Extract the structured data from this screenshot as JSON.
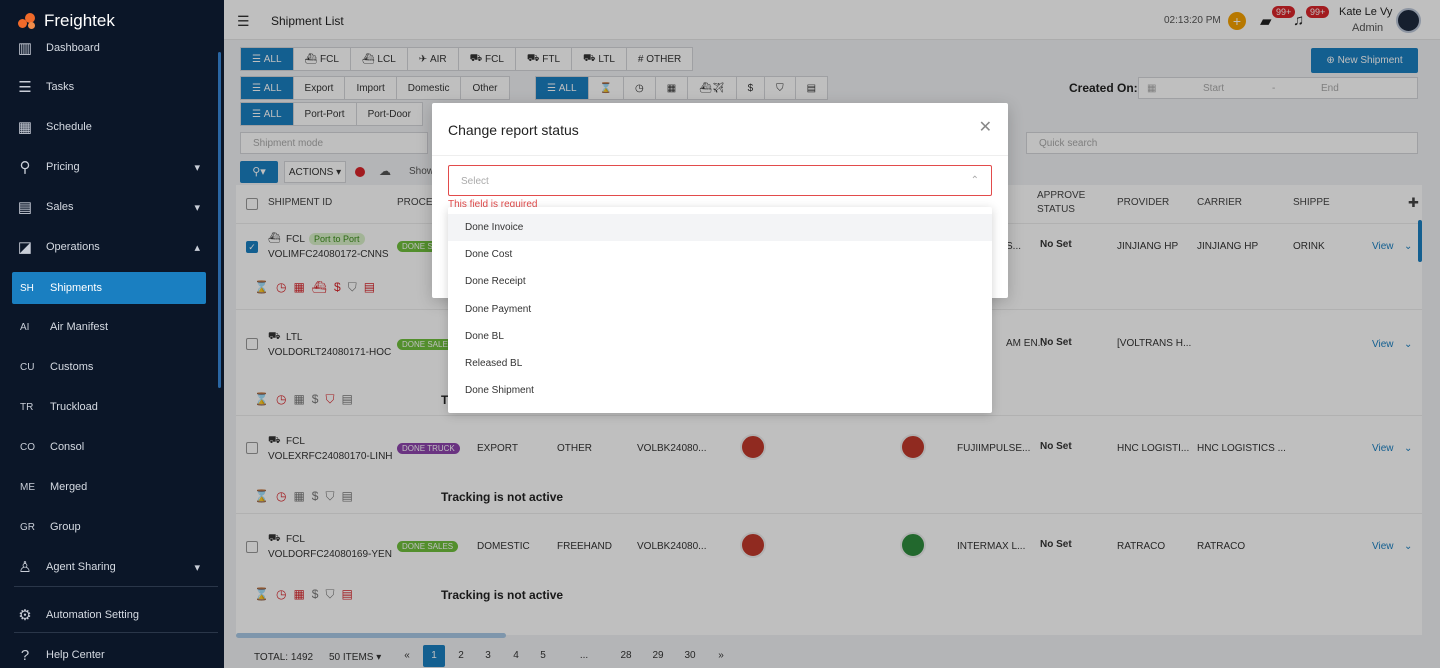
{
  "app": {
    "brand": "Freightek"
  },
  "header": {
    "title": "Shipment List",
    "time": "02:13:20 PM",
    "msg_badge": "99+",
    "notif_badge": "99+",
    "user_name": "Kate Le Vy",
    "user_role": "Admin"
  },
  "sidebar": {
    "items": [
      {
        "label": "Dashboard"
      },
      {
        "label": "Tasks"
      },
      {
        "label": "Schedule"
      },
      {
        "label": "Pricing"
      },
      {
        "label": "Sales"
      },
      {
        "label": "Operations"
      }
    ],
    "sub": [
      {
        "abbr": "SH",
        "label": "Shipments"
      },
      {
        "abbr": "AI",
        "label": "Air Manifest"
      },
      {
        "abbr": "CU",
        "label": "Customs"
      },
      {
        "abbr": "TR",
        "label": "Truckload"
      },
      {
        "abbr": "CO",
        "label": "Consol"
      },
      {
        "abbr": "ME",
        "label": "Merged"
      },
      {
        "abbr": "GR",
        "label": "Group"
      }
    ],
    "agent_sharing": "Agent Sharing",
    "automation": "Automation Setting",
    "help": "Help Center"
  },
  "filters": {
    "mode_tabs": [
      "ALL",
      "FCL",
      "LCL",
      "AIR",
      "FCL",
      "FTL",
      "LTL",
      "OTHER"
    ],
    "type_tabs": [
      "ALL",
      "Export",
      "Import",
      "Domestic",
      "Other"
    ],
    "status_tabs": [
      "ALL"
    ],
    "route_tabs": [
      "ALL",
      "Port-Port",
      "Port-Door"
    ],
    "new_shipment": "New Shipment",
    "created_on": "Created On:",
    "date_start": "Start",
    "date_sep": "-",
    "date_end": "End",
    "shipment_mode_placeholder": "Shipment mode",
    "quick_search_placeholder": "Quick search",
    "actions": "ACTIONS",
    "show": "Show"
  },
  "table": {
    "headers": {
      "shipment_id": "SHIPMENT ID",
      "process": "PROCES",
      "approve": "APPROVE",
      "status": "STATUS",
      "provider": "PROVIDER",
      "carrier": "CARRIER",
      "shipper": "SHIPPE"
    },
    "rows": [
      {
        "mode": "FCL",
        "route_tag": "Port to Port",
        "id": "VOLIMFC24080172-CNNS",
        "tag": "DONE S",
        "approve": "No Set",
        "shipper_col": "S...",
        "provider": "JINJIANG HP",
        "carrier": "JINJIANG HP",
        "shipper": "ORINK",
        "view": "View"
      },
      {
        "mode": "LTL",
        "id": "VOLDORLT24080171-HOC",
        "tag": "DONE SALES",
        "approve": "No Set",
        "shipper_col": "AM EN...",
        "provider": "[VOLTRANS H...",
        "carrier": "",
        "view": "View",
        "tracking": "T"
      },
      {
        "mode": "FCL",
        "id": "VOLEXRFC24080170-LINH",
        "tag": "DONE TRUCK",
        "type": "EXPORT",
        "sub": "OTHER",
        "bk": "VOLBK24080...",
        "shipper_col": "FUJIIMPULSE...",
        "approve": "No Set",
        "provider": "HNC LOGISTI...",
        "carrier": "HNC LOGISTICS ...",
        "view": "View",
        "tracking": "Tracking is not active"
      },
      {
        "mode": "FCL",
        "id": "VOLDORFC24080169-YEN",
        "tag": "DONE SALES",
        "type": "DOMESTIC",
        "sub": "FREEHAND",
        "bk": "VOLBK24080...",
        "shipper_col": "INTERMAX L...",
        "approve": "No Set",
        "provider": "RATRACO",
        "carrier": "RATRACO",
        "view": "View",
        "tracking": "Tracking is not active"
      }
    ]
  },
  "footer": {
    "total": "TOTAL: 1492",
    "per_page": "50 ITEMS",
    "pages": [
      "1",
      "2",
      "3",
      "4",
      "5",
      "...",
      "28",
      "29",
      "30"
    ],
    "prev": "«",
    "next": "»"
  },
  "modal": {
    "title": "Change report status",
    "select_placeholder": "Select",
    "error": "This field is required",
    "options": [
      "Done Invoice",
      "Done Cost",
      "Done Receipt",
      "Done Payment",
      "Done BL",
      "Released BL",
      "Done Shipment"
    ]
  }
}
